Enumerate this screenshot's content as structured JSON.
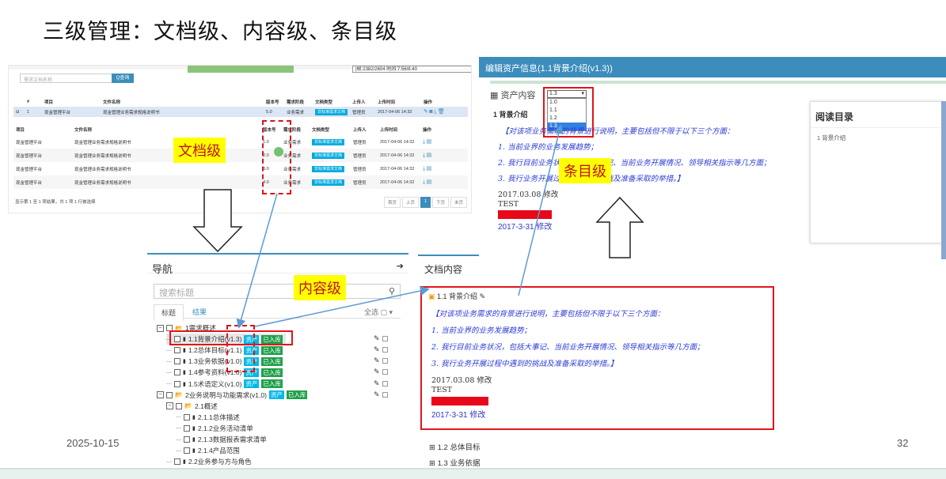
{
  "slide": {
    "title": "三级管理：文档级、内容级、条目级",
    "date": "2025-10-15",
    "page_number": "32",
    "labels": {
      "doc_level": "文档级",
      "content_level": "内容级",
      "item_level": "条目级"
    }
  },
  "doc_list": {
    "search_placeholder": "需求文档名称",
    "query_button": "Q查询",
    "status_bar": "|帧:2382/2604 时间:7:56/8:40",
    "columns": [
      "#",
      "项目",
      "文件名称",
      "版本号",
      "需求阶段",
      "文档类型",
      "上传人",
      "上传时间",
      "操作"
    ],
    "main_row": {
      "toggle": "⊟",
      "index": "1",
      "project": "现金管理平台",
      "filename": "现金管理业务需求规格说明书",
      "version": "5.0",
      "stage": "业务需求",
      "doctype": "非标准需求文档",
      "uploader": "管理员",
      "time": "2017-04-06 14:32"
    },
    "sub_columns": [
      "项目",
      "文件名称",
      "版本号",
      "需求阶段",
      "文档类型",
      "上传人",
      "上传时间",
      "操作"
    ],
    "sub_rows": [
      {
        "project": "现金管理平台",
        "filename": "现金管理业务需求规格说明书",
        "version": "1.0",
        "stage": "业务需求",
        "doctype": "非标准需求文档",
        "uploader": "管理员",
        "time": "2017-04-06 14:32"
      },
      {
        "project": "现金管理平台",
        "filename": "现金管理业务需求规格说明书",
        "version": "2.0",
        "stage": "业务需求",
        "doctype": "非标准需求文档",
        "uploader": "管理员",
        "time": "2017-04-06 14:32"
      },
      {
        "project": "现金管理平台",
        "filename": "现金管理业务需求规格说明书",
        "version": "3.0",
        "stage": "业务需求",
        "doctype": "非标准需求文档",
        "uploader": "管理员",
        "time": "2017-04-06 14:32"
      },
      {
        "project": "现金管理平台",
        "filename": "现金管理业务需求规格说明书",
        "version": "4.0",
        "stage": "业务需求",
        "doctype": "非标准需求文档",
        "uploader": "管理员",
        "time": "2017-04-06 14:32"
      }
    ],
    "footer": "显示第 1 至 1 项结果，共 1 项   1 行被选择",
    "pager": [
      "首页",
      "上页",
      "1",
      "下页",
      "末页"
    ]
  },
  "nav": {
    "title": "导航",
    "search_placeholder": "搜索标题",
    "tabs": [
      "标题",
      "结果"
    ],
    "tab_option": "全选 ▢ ▾",
    "tree": [
      {
        "label": "1需求概述",
        "depth": 0,
        "folder": true,
        "tags": []
      },
      {
        "label": "1.1背景介绍(v1.3)",
        "depth": 1,
        "folder": false,
        "tags": [
          "资产",
          "已入库"
        ],
        "selected": true
      },
      {
        "label": "1.2总体目标(v1.1)",
        "depth": 1,
        "folder": false,
        "tags": [
          "资产",
          "已入库"
        ]
      },
      {
        "label": "1.3业务依据(v1.0)",
        "depth": 1,
        "folder": false,
        "tags": [
          "资产",
          "已入库"
        ]
      },
      {
        "label": "1.4参考资料(v1.0)",
        "depth": 1,
        "folder": false,
        "tags": [
          "资产",
          "已入库"
        ]
      },
      {
        "label": "1.5术语定义(v1.0)",
        "depth": 1,
        "folder": false,
        "tags": [
          "资产",
          "已入库"
        ]
      },
      {
        "label": "2业务说明与功能需求(v1.0)",
        "depth": 0,
        "folder": true,
        "tags": [
          "资产",
          "已入库"
        ]
      },
      {
        "label": "2.1概述",
        "depth": 1,
        "folder": true,
        "tags": []
      },
      {
        "label": "2.1.1总体描述",
        "depth": 2,
        "folder": false,
        "tags": []
      },
      {
        "label": "2.1.2业务活动清单",
        "depth": 2,
        "folder": false,
        "tags": []
      },
      {
        "label": "2.1.3数据报表需求清单",
        "depth": 2,
        "folder": false,
        "tags": []
      },
      {
        "label": "2.1.4产品范围",
        "depth": 2,
        "folder": false,
        "tags": []
      },
      {
        "label": "2.2业务参与方与角色",
        "depth": 1,
        "folder": false,
        "tags": []
      }
    ]
  },
  "doc_content": {
    "title": "文档内容",
    "section_title": "1.1 背景介绍",
    "intro": "【对该项业务需求的背景进行说明，主要包括但不限于以下三个方面：",
    "points": [
      "1. 当前业界的业务发展趋势；",
      "2. 我行目前业务状况，包括大事记、当前业务开展情况、领导相关指示等几方面；",
      "3. 我行业务开展过程中遇到的挑战及准备采取的举措。】"
    ],
    "edit_note": "2017.03.08 修改",
    "test_text": "TEST",
    "red_note": "2017-3-31 修改",
    "blue_note": "2017-3-31 修改",
    "nav_items": [
      "1.2 总体目标",
      "1.3 业务依据"
    ]
  },
  "asset_edit": {
    "title": "编辑资产信息(1.1背景介绍(v1.3))",
    "panel_label": "资产内容",
    "version_selected": "1.3",
    "version_options": [
      "1.0",
      "1.1",
      "1.2",
      "1.3"
    ],
    "heading": "1 背景介绍",
    "intro": "【对该项业务需求的背景进行说明，主要包括但不限于以下三个方面：",
    "points": [
      "1. 当前业界的业务发展趋势；",
      "2. 我行目前业务状况，包括大事记、当前业务开展情况、领导相关指示等几方面；",
      "3. 我行业务开展过程中遇到的挑战及准备采取的举措。】"
    ],
    "edit_note": "2017.03.08 修改",
    "test_text": "TEST",
    "red_note": "2017-3-31 修改",
    "blue_note": "2017-3-31 修改",
    "toc_title": "阅读目录",
    "toc_item": "1 背景介绍"
  },
  "colors": {
    "accent": "#3c8dbc",
    "red": "#e0161c",
    "yellow": "#ffff00",
    "tag_cyan": "#00b8e6",
    "tag_green": "#20a04a",
    "link_blue": "#2a3bd6"
  }
}
